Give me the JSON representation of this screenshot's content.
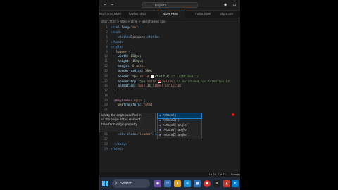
{
  "titlebar": {
    "search_text": "Project5"
  },
  "tabs": [
    {
      "label": "keyframe.html"
    },
    {
      "label": "loader.html"
    },
    {
      "label": "short.html",
      "active": true
    },
    {
      "label": "index.html"
    },
    {
      "label": "style.css"
    }
  ],
  "breadcrumb": "short.html > html > style > @keyframes spin",
  "code_lines": [
    {
      "n": "1",
      "html": "<span class='tag'>&lt;html</span> <span class='attr'>lang</span><span class='txt'>=</span><span class='str'>\"en\"</span><span class='tag'>&gt;</span>"
    },
    {
      "n": "2",
      "html": "<span class='tag'>&lt;head&gt;</span>"
    },
    {
      "n": "6",
      "html": "    <span class='tag'>&lt;title&gt;</span><span class='txt'>Document</span><span class='tag'>&lt;/title&gt;</span>"
    },
    {
      "n": "7",
      "html": "<span class='tag'>&lt;/head&gt;</span>"
    },
    {
      "n": "8",
      "html": "<span class='tag'>&lt;style&gt;</span>"
    },
    {
      "n": "9",
      "html": "  <span class='sel'>.loader</span> <span class='txt'>{</span>"
    },
    {
      "n": "10",
      "html": "    <span class='prop'>width</span><span class='txt'>: </span><span class='num'>150px</span><span class='txt'>;</span>"
    },
    {
      "n": "11",
      "html": "    <span class='prop'>height</span><span class='txt'>: </span><span class='num'>150px</span><span class='txt'>;</span>"
    },
    {
      "n": "12",
      "html": "    <span class='prop'>margin</span><span class='txt'>: </span><span class='num'>0</span> <span class='str'>auto</span><span class='txt'>;</span>"
    },
    {
      "n": "13",
      "html": "    <span class='prop'>border-radius</span><span class='txt'>: </span><span class='num'>50%</span><span class='txt'>;</span>"
    },
    {
      "n": "14",
      "html": "    <span class='prop'>border</span><span class='txt'>: </span><span class='num'>5px</span> <span class='str'>solid</span> <span class='colorbox' style='background:#f3f3f3'></span><span class='num'>#f3f3f3</span><span class='txt'>;</span> <span class='cmt'>/* Light Red */</span>"
    },
    {
      "n": "15",
      "html": "    <span class='prop'>border-top</span><span class='txt'>: </span><span class='num'>5px</span> <span class='str'>solid</span> <span class='colorbox' style='background:#ff0000'></span><span class='str'>yellow</span><span class='txt'>;</span> <span class='cmt'>/* Solid Red for Animation Ef</span>"
    },
    {
      "n": "16",
      "html": "    <span class='prop'>animation</span><span class='txt'>: </span><span class='str'>spin</span> <span class='num'>1s</span> <span class='str'>linear infinite</span><span class='txt'>;</span>"
    },
    {
      "n": "17",
      "html": "  <span class='txt'>}</span>"
    },
    {
      "n": "18",
      "html": ""
    },
    {
      "n": "19",
      "html": "  <span class='kw'>@keyframes</span> <span class='str'>spin</span> <span class='txt'>{</span>"
    },
    {
      "n": "20",
      "html": "    <span class='sel'>0%</span><span class='txt'>{</span><span class='prop'>transform</span><span class='txt'>: </span><span class='str'>rota</span><span class='txt'>|</span>"
    },
    {
      "n": "21",
      "html": ""
    },
    {
      "n": "22",
      "html": ""
    },
    {
      "n": "23",
      "html": ""
    },
    {
      "n": "24",
      "html": ""
    },
    {
      "n": "25",
      "html": "    <span class='tag'>&lt;/body&gt;</span>"
    },
    {
      "n": "26",
      "html": "    <span class='tag'>&lt;div</span> <span class='attr'>class</span><span class='txt'>=</span><span class='str'>\"loader\"</span><span class='tag'>&gt;&lt;/div&gt;</span>"
    },
    {
      "n": "27",
      "html": ""
    },
    {
      "n": "28",
      "html": "  <span class='tag'>&lt;/body&gt;</span>"
    },
    {
      "n": "29",
      "html": "<span class='tag'>&lt;/html&gt;</span>"
    }
  ],
  "suggestions": [
    {
      "label": "rotate()",
      "active": true
    },
    {
      "label": "rotate3d()"
    },
    {
      "label": "rotateX('angle')"
    },
    {
      "label": "rotateY('angle')"
    },
    {
      "label": "rotateZ('angle')"
    }
  ],
  "hover_doc": [
    "ion by the angle specified in",
    "ut the origin of the element.",
    "transform-origin property."
  ],
  "statusbar": {
    "position": "Ln 20, Col 22",
    "spaces": "Spaces"
  },
  "taskbar": {
    "search_label": "Search"
  },
  "colors": {
    "accent": "#0078d4",
    "editor_bg": "#1e1e1e",
    "taskbar_bg": "#202a3a"
  }
}
